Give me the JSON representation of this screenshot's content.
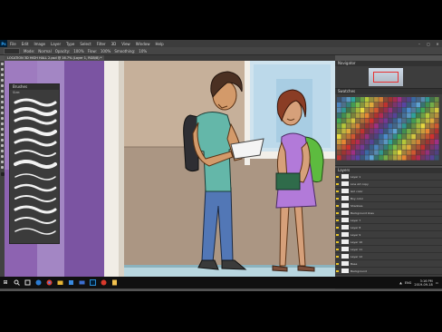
{
  "app": {
    "logo": "Ps",
    "menu": [
      "File",
      "Edit",
      "Image",
      "Layer",
      "Type",
      "Select",
      "Filter",
      "3D",
      "View",
      "Window",
      "Help"
    ],
    "window_controls": [
      "–",
      "▢",
      "✕"
    ]
  },
  "options_bar": {
    "items": [
      "Mode:",
      "Normal",
      "Opacity:",
      "100%",
      "Flow:",
      "100%",
      "Smoothing:",
      "10%"
    ]
  },
  "document_tab": {
    "title": "LOCATION 3D HIGH HALL 2.psd @ 16.7% (Layer 1, RGB/8) *"
  },
  "brush_panel": {
    "title": "Brushes",
    "size_label": "Size:"
  },
  "navigator": {
    "title": "Navigator"
  },
  "swatches": {
    "title": "Swatches",
    "colors": [
      "#3a6fb0",
      "#4c8fd4",
      "#63b0e6",
      "#2fa8a0",
      "#46b65a",
      "#7fc24a",
      "#c5d93a",
      "#f0e040",
      "#f4b73c",
      "#ef8a33",
      "#e35b2f",
      "#d8302c",
      "#c02a55",
      "#a32f87",
      "#7a3aa0",
      "#5a44a8"
    ]
  },
  "layers": {
    "title": "Layers",
    "items": [
      "Layer 1",
      "Line Art copy",
      "Girl color",
      "Boy color",
      "Shadows",
      "Background lines",
      "Layer 7",
      "Layer 8",
      "Layer 9",
      "Layer 10",
      "Layer 11",
      "Layer 12",
      "Base",
      "Background"
    ]
  },
  "taskbar": {
    "start": "⊞",
    "icons": [
      "search",
      "task-view",
      "edge",
      "chrome",
      "explorer",
      "store",
      "mail",
      "photoshop",
      "media",
      "files"
    ],
    "tray_lang": "ENG",
    "time": "3:16 PM",
    "date": "2019-09-18"
  },
  "colors": {
    "brand": "#31a8ff",
    "panel": "#3d3d3d",
    "girl_dress": "#b27ad9",
    "girl_backpack": "#5dbb3f",
    "boy_shirt": "#64b7a9",
    "boy_jeans": "#5277b6",
    "wall_purple": "#8d63b1"
  }
}
